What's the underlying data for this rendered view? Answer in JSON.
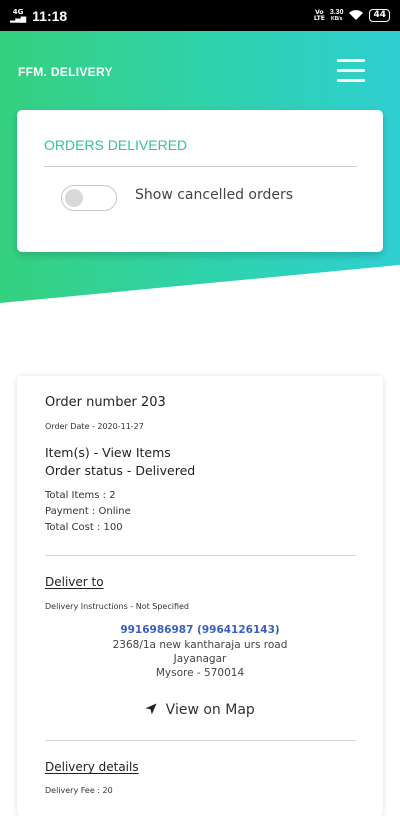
{
  "status_bar": {
    "network": "4G",
    "signal": "▂▄▆",
    "time": "11:18",
    "volte": "Vo",
    "lte": "LTE",
    "speed_value": "3.30",
    "speed_unit": "KB/s",
    "battery": "44",
    "wifi_icon": "wifi-icon"
  },
  "header": {
    "brand": "FFM. DELIVERY",
    "menu_icon": "hamburger-menu-icon",
    "gradient_colors": [
      "#35d17f",
      "#2fcfd2"
    ]
  },
  "filter_card": {
    "title": "ORDERS DELIVERED",
    "title_color": "#35c58a",
    "toggle_label": "Show cancelled orders",
    "toggle_on": false
  },
  "order": {
    "number": "Order number 203",
    "date": "Order Date - 2020-11-27",
    "items_link": "Item(s) - View Items",
    "status": "Order status - Delivered",
    "total_items": "Total Items : 2",
    "payment": "Payment : Online",
    "total_cost": "Total Cost : 100",
    "deliver_to": {
      "heading": "Deliver to",
      "instructions": "Delivery Instructions - Not Specified",
      "phone": "9916986987 (9964126143)",
      "address_line1": "2368/1a new kantharaja urs road",
      "address_line2": "Jayanagar",
      "address_line3": "Mysore - 570014",
      "map_link": "View on Map",
      "map_icon": "location-arrow-icon"
    },
    "delivery_details": {
      "heading": "Delivery details",
      "fee": "Delivery Fee : 20"
    }
  }
}
